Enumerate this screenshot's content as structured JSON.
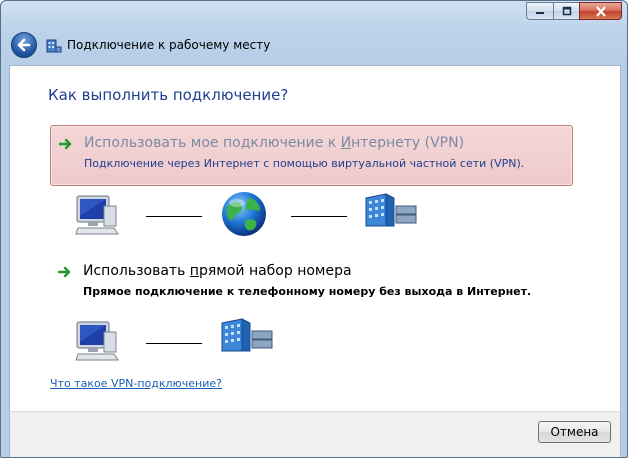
{
  "window": {
    "title": "Подключение к рабочему месту"
  },
  "main": {
    "heading": "Как выполнить подключение?",
    "options": [
      {
        "title_pre": "Использовать мое подключение к ",
        "title_key": "И",
        "title_post": "нтернету (VPN)",
        "subtitle": "Подключение через Интернет с помощью виртуальной частной сети (VPN).",
        "selected": true
      },
      {
        "title_pre": "Использовать ",
        "title_key": "п",
        "title_post": "рямой набор номера",
        "subtitle": "Прямое подключение к телефонному номеру без выхода в Интернет.",
        "selected": false
      }
    ],
    "help_link": "Что такое VPN-подключение?"
  },
  "footer": {
    "cancel_label": "Отмена"
  },
  "icons": {
    "back": "back-arrow-icon",
    "workplace": "workplace-network-icon",
    "option_arrow": "green-arrow-icon",
    "computer": "computer-icon",
    "globe": "globe-icon",
    "server": "building-icon"
  },
  "colors": {
    "heading": "#1f3f8f",
    "selected_bg": "#efc9cb",
    "link": "#1a5fb8"
  }
}
